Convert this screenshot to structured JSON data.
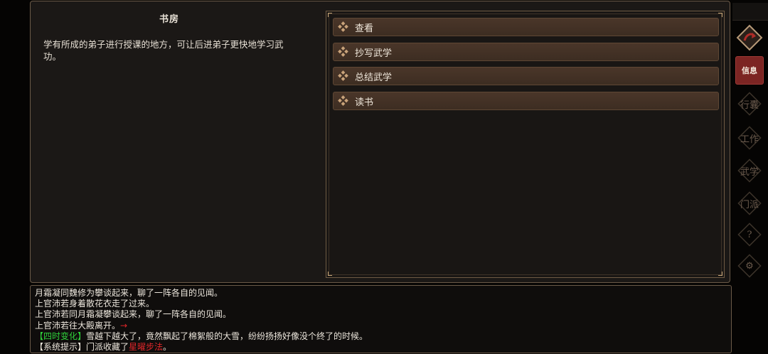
{
  "panel": {
    "title": "书房",
    "description": "学有所成的弟子进行授课的地方，可让后进弟子更快地学习武功。"
  },
  "actions": [
    {
      "label": "查看"
    },
    {
      "label": "抄写武学"
    },
    {
      "label": "总结武学"
    },
    {
      "label": "读书"
    }
  ],
  "side_menu": {
    "info_label": "信息",
    "items": [
      {
        "label": "行囊"
      },
      {
        "label": "工作"
      },
      {
        "label": "武学"
      },
      {
        "label": "门派"
      },
      {
        "label": "?"
      },
      {
        "label": "⚙"
      }
    ]
  },
  "log": {
    "line1": "月霜凝同魏修为攀谈起来，聊了一阵各自的见闻。",
    "line2": "上官沛若身着散花衣走了过来。",
    "line3": "上官沛若同月霜凝攀谈起来，聊了一阵各自的见闻。",
    "line4": "上官沛若往大殿离开。",
    "line4_arrow": "→",
    "line5_tag": "【四时变化】",
    "line5_text": "雪越下越大了，竟然飘起了棉絮般的大雪，纷纷扬扬好像没个终了的时候。",
    "line6_tag": "【系统提示】",
    "line6_text": "门派收藏了",
    "line6_highlight": "星曜步法",
    "line6_end": "。"
  },
  "colors": {
    "accent_red": "#7c2523",
    "log_green": "#2fd13b",
    "log_red": "#e0262a",
    "button_bg": "#45332a"
  }
}
